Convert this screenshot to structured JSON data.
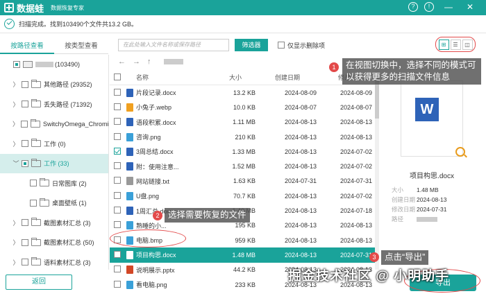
{
  "window": {
    "app_name": "数据蛙",
    "subtitle": "数据恢复专家",
    "help_glyph": "?",
    "feedback_glyph": "!",
    "minimize_glyph": "—",
    "close_glyph": "✕"
  },
  "status": {
    "text": "扫描完成。找到103490个文件共13.2 GB。"
  },
  "left_tabs": [
    {
      "label": "按路径查看",
      "active": true
    },
    {
      "label": "按类型查看",
      "active": false
    }
  ],
  "tree": [
    {
      "arrow": "",
      "label": "(103490)",
      "depth": 0,
      "check": "part",
      "icon": "pc",
      "blur": true
    },
    {
      "arrow": "〉",
      "label": "其他路径 (29352)",
      "depth": 1,
      "check": "off",
      "icon": "folder"
    },
    {
      "arrow": "〉",
      "label": "丢失路径 (71392)",
      "depth": 1,
      "check": "off",
      "icon": "folder"
    },
    {
      "arrow": "〉",
      "label": "SwitchyOmega_Chromium",
      "depth": 1,
      "check": "off",
      "icon": "folder"
    },
    {
      "arrow": "〉",
      "label": "工作 (0)",
      "depth": 1,
      "check": "off",
      "icon": "folder"
    },
    {
      "arrow": "﹀",
      "label": "工作 (33)",
      "depth": 1,
      "check": "part",
      "icon": "folder",
      "selected": true
    },
    {
      "arrow": "",
      "label": "日常图库 (2)",
      "depth": 2,
      "check": "off",
      "icon": "folder"
    },
    {
      "arrow": "",
      "label": "桌面壁纸 (1)",
      "depth": 2,
      "check": "off",
      "icon": "folder"
    },
    {
      "arrow": "〉",
      "label": "截图素材汇总 (3)",
      "depth": 1,
      "check": "off",
      "icon": "folder"
    },
    {
      "arrow": "〉",
      "label": "截图素材汇总 (50)",
      "depth": 1,
      "check": "off",
      "icon": "folder"
    },
    {
      "arrow": "〉",
      "label": "语料素材汇总 (3)",
      "depth": 1,
      "check": "off",
      "icon": "folder"
    }
  ],
  "toolbar": {
    "search_placeholder": "在此处输入文件名称或保存路径",
    "filter_label": "筛选器",
    "deleted_only_label": "仅显示删除项"
  },
  "view_modes": [
    "⊞",
    "☰",
    "◫"
  ],
  "nav": {
    "back": "←",
    "forward": "→",
    "up": "↑"
  },
  "columns": {
    "name": "名称",
    "size": "大小",
    "created": "创建日期",
    "modified": "修改"
  },
  "files": [
    {
      "name": "片段记录.docx",
      "size": "13.2 KB",
      "created": "2024-08-09",
      "modified": "2024-08-09",
      "checked": false,
      "color": "#2e63b8"
    },
    {
      "name": "小兔子.webp",
      "size": "10.0 KB",
      "created": "2024-08-07",
      "modified": "2024-08-07",
      "checked": false,
      "color": "#f0a020"
    },
    {
      "name": "语段积累.docx",
      "size": "1.11 MB",
      "created": "2024-08-13",
      "modified": "2024-08-13",
      "checked": false,
      "color": "#2e63b8"
    },
    {
      "name": "咨询.png",
      "size": "210 KB",
      "created": "2024-08-13",
      "modified": "2024-08-13",
      "checked": false,
      "color": "#3aa0d8"
    },
    {
      "name": "3周总结.docx",
      "size": "1.33 MB",
      "created": "2024-08-13",
      "modified": "2024-07-02",
      "checked": true,
      "color": "#2e63b8"
    },
    {
      "name": "附：使用注意...",
      "size": "1.52 MB",
      "created": "2024-08-13",
      "modified": "2024-07-02",
      "checked": false,
      "color": "#2e63b8"
    },
    {
      "name": "网站链接.txt",
      "size": "1.63 KB",
      "created": "2024-07-31",
      "modified": "2024-07-31",
      "checked": false,
      "color": "#999999"
    },
    {
      "name": "U盘.png",
      "size": "70.7 KB",
      "created": "2024-08-13",
      "modified": "2024-07-02",
      "checked": false,
      "color": "#3aa0d8"
    },
    {
      "name": "1周汇总.docx",
      "size": "1.40 MB",
      "created": "2024-08-13",
      "modified": "2024-07-18",
      "checked": false,
      "color": "#2e63b8"
    },
    {
      "name": "熟睡的小...",
      "size": "195 KB",
      "created": "2024-08-13",
      "modified": "2024-08-13",
      "checked": false,
      "color": "#3aa0d8"
    },
    {
      "name": "电脑.bmp",
      "size": "959 KB",
      "created": "2024-08-13",
      "modified": "2024-08-13",
      "checked": false,
      "color": "#3aa0d8"
    },
    {
      "name": "项目构思.docx",
      "size": "1.48 MB",
      "created": "2024-08-13",
      "modified": "2024-07-31",
      "checked": false,
      "color": "#ffffff",
      "selected": true
    },
    {
      "name": "说明展示.pptx",
      "size": "44.2 KB",
      "created": "2024-08-13",
      "modified": "2024-08-13",
      "checked": false,
      "color": "#d24726"
    },
    {
      "name": "看电脑.png",
      "size": "233 KB",
      "created": "2024-08-13",
      "modified": "2024-08-13",
      "checked": false,
      "color": "#3aa0d8"
    }
  ],
  "preview": {
    "doc_letter": "W",
    "file_name": "项目构思.docx",
    "size_label": "大小",
    "size": "1.48 MB",
    "created_label": "创建日期",
    "created": "2024-08-13",
    "modified_label": "修改日期",
    "modified": "2024-07-31",
    "path_label": "路径"
  },
  "buttons": {
    "back": "返回",
    "export": "导出"
  },
  "callouts": [
    {
      "num": "1",
      "text": "在视图切换中，选择不同的模式可以获得更多的扫描文件信息"
    },
    {
      "num": "2",
      "text": "选择需要恢复的文件"
    },
    {
      "num": "3",
      "text": "点击“导出”"
    }
  ],
  "watermark": "掘金技术社区 @ 小明助手",
  "colors": {
    "brand": "#1aa39a",
    "annotation": "#e34a4a"
  }
}
